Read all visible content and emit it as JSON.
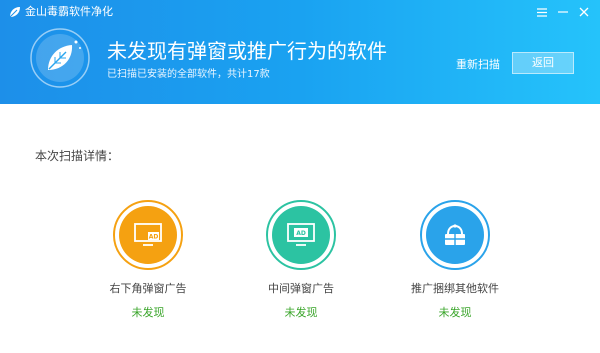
{
  "app": {
    "title": "金山毒霸软件净化"
  },
  "hero": {
    "title": "未发现有弹窗或推广行为的软件",
    "subtitle": "已扫描已安装的全部软件，共计17款"
  },
  "actions": {
    "rescan_label": "重新扫描",
    "back_label": "返回"
  },
  "details": {
    "label": "本次扫描详情："
  },
  "items": [
    {
      "label": "右下角弹窗广告",
      "status": "未发现",
      "icon": "corner-ad-icon",
      "color": "#f5a111"
    },
    {
      "label": "中间弹窗广告",
      "status": "未发现",
      "icon": "center-ad-icon",
      "color": "#2cc3a2"
    },
    {
      "label": "推广捆绑其他软件",
      "status": "未发现",
      "icon": "bundle-icon",
      "color": "#2aa3ea"
    }
  ],
  "colors": {
    "header_start": "#1d8fe9",
    "header_end": "#25c3fb",
    "status_green": "#3aa52a"
  }
}
